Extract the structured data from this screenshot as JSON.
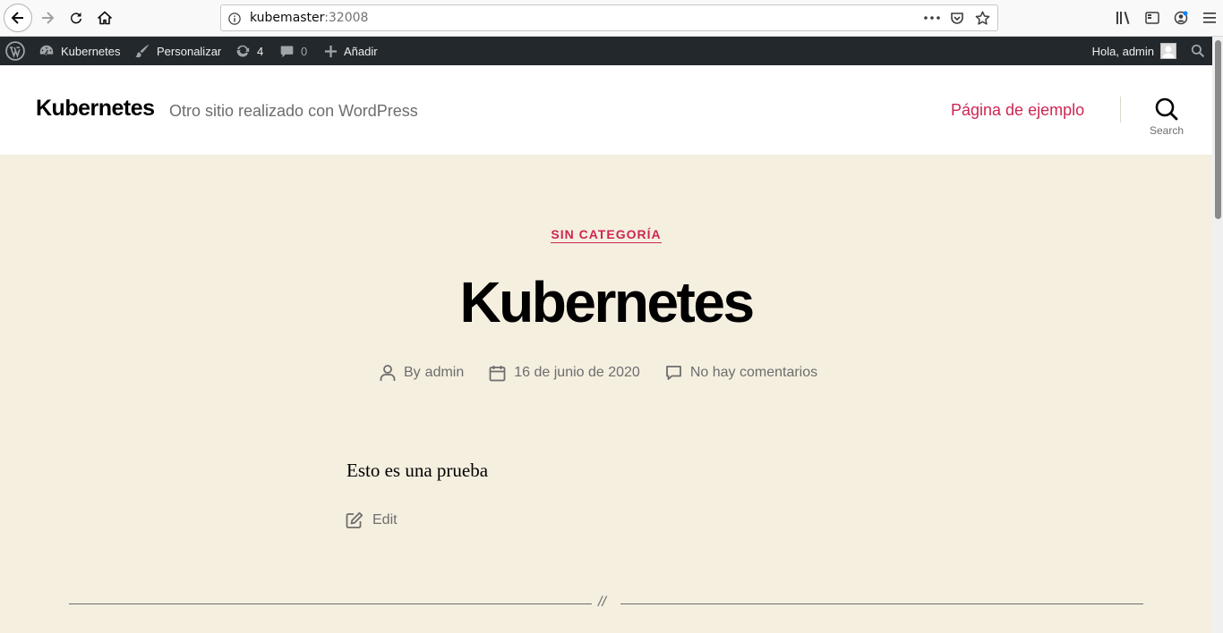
{
  "browser": {
    "url_host": "kubemaster",
    "url_port": ":32008"
  },
  "adminbar": {
    "site_name": "Kubernetes",
    "customize": "Personalizar",
    "updates_count": "4",
    "comments_count": "0",
    "new_label": "Añadir",
    "howdy": "Hola, admin"
  },
  "header": {
    "site_title": "Kubernetes",
    "site_description": "Otro sitio realizado con WordPress",
    "menu_item": "Página de ejemplo",
    "search_label": "Search"
  },
  "post": {
    "category": "SIN CATEGORÍA",
    "title": "Kubernetes",
    "author_prefix": "By",
    "author": "admin",
    "date": "16 de junio de 2020",
    "comments": "No hay comentarios",
    "body": "Esto es una prueba",
    "edit_label": "Edit",
    "separator": "//"
  },
  "colors": {
    "accent": "#cd2653",
    "background": "#f5efe0",
    "adminbar": "#23282d"
  }
}
